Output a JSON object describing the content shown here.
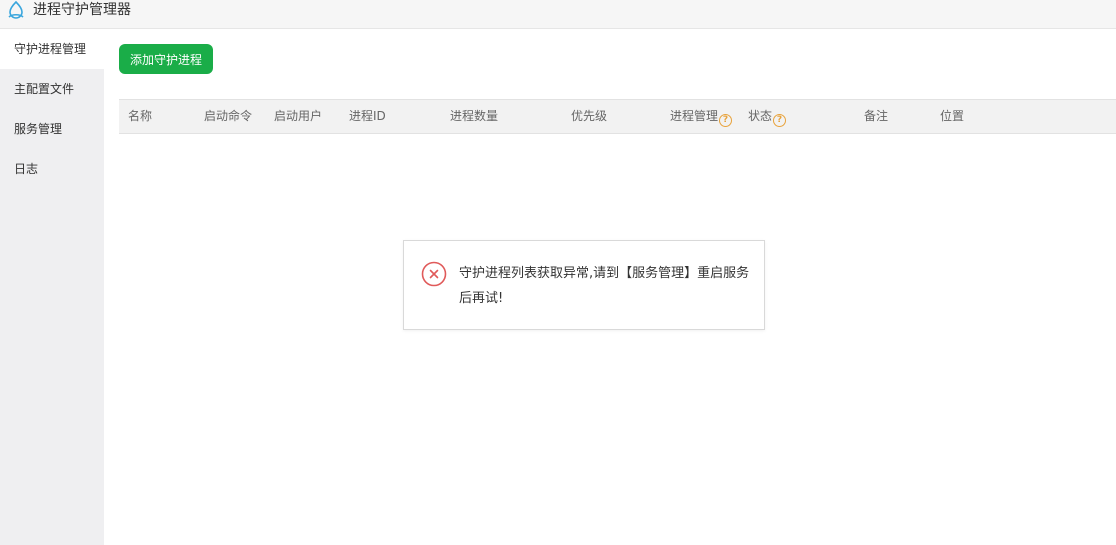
{
  "app": {
    "title": "进程守护管理器",
    "logo_icon": "snake-logo-icon"
  },
  "sidebar": {
    "items": [
      {
        "label": "守护进程管理",
        "active": true
      },
      {
        "label": "主配置文件",
        "active": false
      },
      {
        "label": "服务管理",
        "active": false
      },
      {
        "label": "日志",
        "active": false
      }
    ]
  },
  "toolbar": {
    "add_label": "添加守护进程",
    "add_color": "#1aad48"
  },
  "table": {
    "columns": [
      "名称",
      "启动命令",
      "启动用户",
      "进程ID",
      "进程数量",
      "优先级",
      "进程管理",
      "状态",
      "备注",
      "位置"
    ],
    "help_mark": "?"
  },
  "toast": {
    "message": "守护进程列表获取异常,请到【服务管理】重启服务后再试!",
    "icon": "error-circle-icon",
    "color": "#e05a5a"
  }
}
